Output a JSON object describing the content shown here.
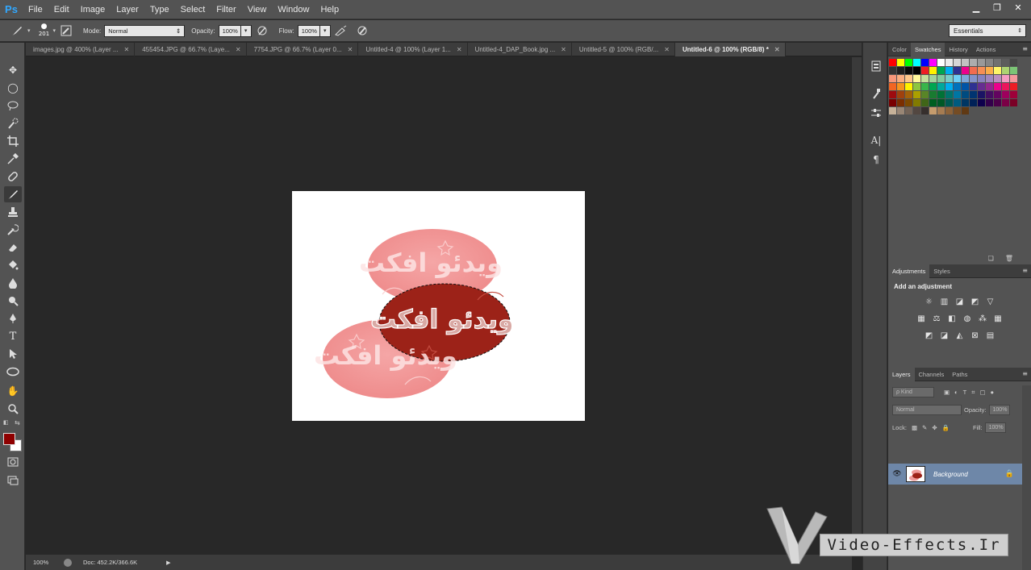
{
  "app": {
    "logo": "Ps"
  },
  "menu": [
    "File",
    "Edit",
    "Image",
    "Layer",
    "Type",
    "Select",
    "Filter",
    "View",
    "Window",
    "Help"
  ],
  "window_controls": {
    "minimize": "▁",
    "restore": "❐",
    "close": "✕"
  },
  "options": {
    "brush_size": "201",
    "mode_label": "Mode:",
    "mode_value": "Normal",
    "opacity_label": "Opacity:",
    "opacity_value": "100%",
    "flow_label": "Flow:",
    "flow_value": "100%",
    "workspace": "Essentials"
  },
  "tabs": [
    {
      "label": "images.jpg @ 400% (Layer ..."
    },
    {
      "label": "455454.JPG @ 66.7% (Laye..."
    },
    {
      "label": "7754.JPG @ 66.7% (Layer 0..."
    },
    {
      "label": "Untitled-4 @ 100% (Layer 1..."
    },
    {
      "label": "Untitled-4_DAP_Book.jpg ..."
    },
    {
      "label": "Untitled-5 @ 100% (RGB/..."
    },
    {
      "label": "Untitled-6 @ 100% (RGB/8) *",
      "active": true
    }
  ],
  "document": {
    "logo_text": "ويدئو افكت"
  },
  "status": {
    "zoom": "100%",
    "doc": "Doc: 452.2K/366.6K"
  },
  "colors": {
    "foreground": "#8e0000",
    "background": "#ffffff",
    "selected_layer": "#6e87a8"
  },
  "panels": {
    "color_tabs": [
      "Color",
      "Swatches",
      "History",
      "Actions"
    ],
    "adjust_tabs": [
      "Adjustments",
      "Styles"
    ],
    "adjust_title": "Add an adjustment",
    "layer_tabs": [
      "Layers",
      "Channels",
      "Paths"
    ],
    "kind_label": "ρ Kind",
    "blend_mode": "Normal",
    "opacity_label": "Opacity:",
    "opacity_value": "100%",
    "lock_label": "Lock:",
    "fill_label": "Fill:",
    "fill_value": "100%",
    "layer_name": "Background"
  },
  "watermark": {
    "text": "Video-Effects.Ir"
  }
}
